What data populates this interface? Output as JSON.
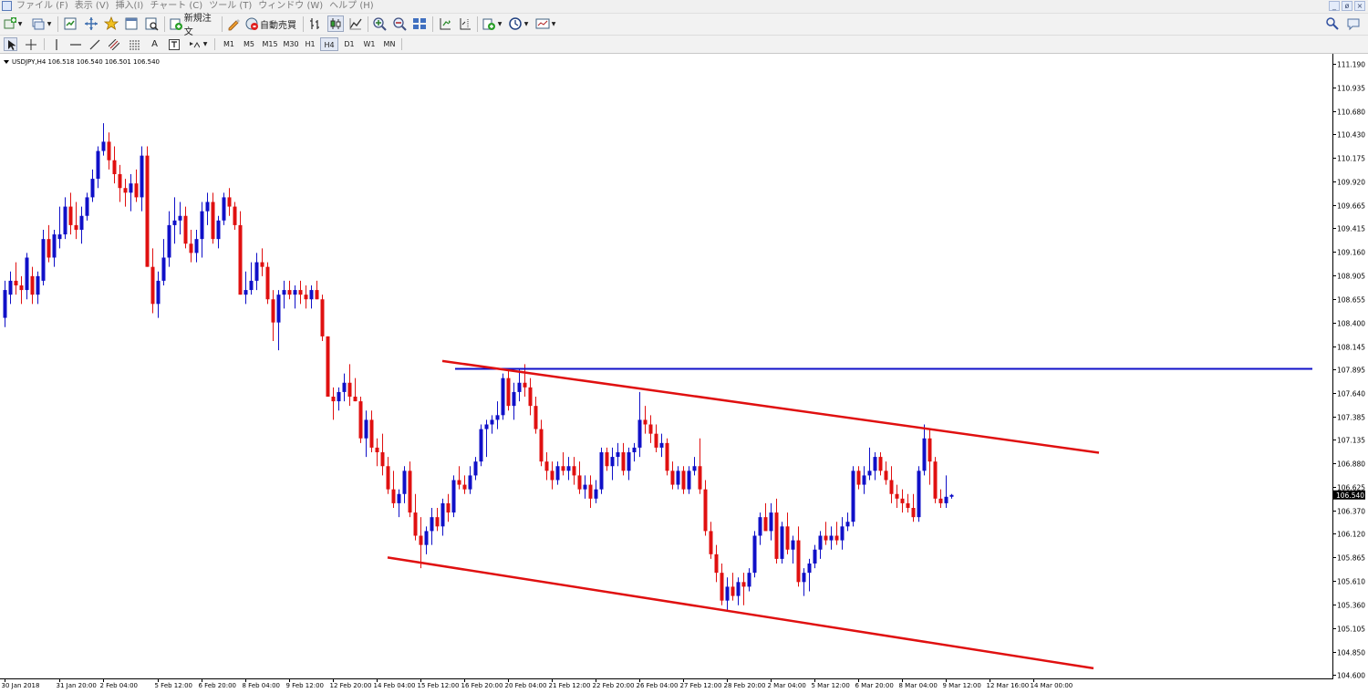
{
  "menu": {
    "items": [
      "ファイル (F)",
      "表示 (V)",
      "挿入(I)",
      "チャート (C)",
      "ツール (T)",
      "ウィンドウ (W)",
      "ヘルプ (H)"
    ]
  },
  "window_controls": [
    "_",
    "ø",
    "×"
  ],
  "toolbar": {
    "new_order_label": "新規注文",
    "auto_trade_label": "自動売買"
  },
  "timeframes": [
    "M1",
    "M5",
    "M15",
    "M30",
    "H1",
    "H4",
    "D1",
    "W1",
    "MN"
  ],
  "active_timeframe": "H4",
  "symbol_info": "USDJPY,H4  106.518 106.540 106.501 106.540",
  "colors": {
    "bull": "#1010c8",
    "bear": "#e01010",
    "trendline": "#e01010",
    "horizontal_line": "#1010c8",
    "price_tag_bg": "#000000"
  },
  "chart_data": {
    "type": "candlestick",
    "symbol": "USDJPY",
    "timeframe": "H4",
    "ylim": [
      104.475,
      111.313
    ],
    "price_ticks": [
      "111.190",
      "110.935",
      "110.680",
      "110.430",
      "110.175",
      "109.920",
      "109.665",
      "109.415",
      "109.160",
      "108.905",
      "108.655",
      "108.400",
      "108.145",
      "107.895",
      "107.640",
      "107.385",
      "107.135",
      "106.880",
      "106.625",
      "106.370",
      "106.120",
      "105.865",
      "105.610",
      "105.360",
      "105.105",
      "104.850",
      "104.600"
    ],
    "current_price": "106.540",
    "date_ticks": [
      {
        "label": "30 Jan 2018",
        "index": 0
      },
      {
        "label": "31 Jan 20:00",
        "index": 10
      },
      {
        "label": "2 Feb 04:00",
        "index": 18
      },
      {
        "label": "5 Feb 12:00",
        "index": 28
      },
      {
        "label": "6 Feb 20:00",
        "index": 36
      },
      {
        "label": "8 Feb 04:00",
        "index": 44
      },
      {
        "label": "9 Feb 12:00",
        "index": 52
      },
      {
        "label": "12 Feb 20:00",
        "index": 60
      },
      {
        "label": "14 Feb 04:00",
        "index": 68
      },
      {
        "label": "15 Feb 12:00",
        "index": 76
      },
      {
        "label": "16 Feb 20:00",
        "index": 84
      },
      {
        "label": "20 Feb 04:00",
        "index": 92
      },
      {
        "label": "21 Feb 12:00",
        "index": 100
      },
      {
        "label": "22 Feb 20:00",
        "index": 108
      },
      {
        "label": "26 Feb 04:00",
        "index": 116
      },
      {
        "label": "27 Feb 12:00",
        "index": 124
      },
      {
        "label": "28 Feb 20:00",
        "index": 132
      },
      {
        "label": "2 Mar 04:00",
        "index": 140
      },
      {
        "label": "5 Mar 12:00",
        "index": 148
      },
      {
        "label": "6 Mar 20:00",
        "index": 156
      },
      {
        "label": "8 Mar 04:00",
        "index": 164
      },
      {
        "label": "9 Mar 12:00",
        "index": 172
      },
      {
        "label": "12 Mar 16:00",
        "index": 180
      },
      {
        "label": "14 Mar 00:00",
        "index": 188
      }
    ],
    "candles": [
      [
        108.45,
        108.85,
        108.35,
        108.75
      ],
      [
        108.7,
        108.95,
        108.6,
        108.85
      ],
      [
        108.85,
        109.05,
        108.7,
        108.8
      ],
      [
        108.8,
        108.9,
        108.6,
        108.75
      ],
      [
        108.75,
        109.15,
        108.65,
        109.1
      ],
      [
        108.9,
        109.0,
        108.6,
        108.7
      ],
      [
        108.7,
        108.95,
        108.6,
        108.9
      ],
      [
        108.85,
        109.4,
        108.8,
        109.3
      ],
      [
        109.3,
        109.45,
        109.05,
        109.1
      ],
      [
        109.1,
        109.4,
        109.0,
        109.35
      ],
      [
        109.3,
        109.65,
        109.2,
        109.35
      ],
      [
        109.35,
        109.75,
        109.3,
        109.65
      ],
      [
        109.65,
        109.8,
        109.35,
        109.45
      ],
      [
        109.45,
        109.7,
        109.3,
        109.4
      ],
      [
        109.4,
        109.65,
        109.25,
        109.55
      ],
      [
        109.55,
        109.8,
        109.5,
        109.75
      ],
      [
        109.75,
        110.05,
        109.7,
        109.95
      ],
      [
        109.95,
        110.3,
        109.85,
        110.25
      ],
      [
        110.25,
        110.55,
        110.2,
        110.35
      ],
      [
        110.35,
        110.45,
        110.05,
        110.15
      ],
      [
        110.15,
        110.3,
        109.9,
        110.0
      ],
      [
        110.0,
        110.1,
        109.7,
        109.85
      ],
      [
        109.85,
        109.95,
        109.65,
        109.8
      ],
      [
        109.8,
        110.0,
        109.6,
        109.9
      ],
      [
        109.9,
        110.05,
        109.7,
        109.75
      ],
      [
        109.75,
        110.3,
        109.6,
        110.2
      ],
      [
        110.2,
        110.3,
        109.0,
        109.0
      ],
      [
        109.0,
        109.2,
        108.5,
        108.6
      ],
      [
        108.6,
        108.95,
        108.45,
        108.85
      ],
      [
        108.85,
        109.3,
        108.8,
        109.1
      ],
      [
        109.1,
        109.6,
        109.0,
        109.45
      ],
      [
        109.45,
        109.75,
        109.25,
        109.5
      ],
      [
        109.5,
        109.7,
        109.35,
        109.55
      ],
      [
        109.55,
        109.65,
        109.2,
        109.25
      ],
      [
        109.25,
        109.4,
        109.05,
        109.15
      ],
      [
        109.15,
        109.4,
        109.05,
        109.3
      ],
      [
        109.3,
        109.7,
        109.1,
        109.6
      ],
      [
        109.6,
        109.8,
        109.45,
        109.7
      ],
      [
        109.7,
        109.8,
        109.25,
        109.3
      ],
      [
        109.3,
        109.55,
        109.2,
        109.5
      ],
      [
        109.5,
        109.8,
        109.45,
        109.75
      ],
      [
        109.75,
        109.85,
        109.55,
        109.65
      ],
      [
        109.65,
        109.7,
        109.4,
        109.45
      ],
      [
        109.45,
        109.6,
        108.7,
        108.7
      ],
      [
        108.7,
        108.95,
        108.6,
        108.75
      ],
      [
        108.75,
        109.05,
        108.7,
        108.85
      ],
      [
        108.85,
        109.15,
        108.75,
        109.05
      ],
      [
        109.05,
        109.2,
        108.9,
        109.0
      ],
      [
        109.0,
        109.05,
        108.6,
        108.65
      ],
      [
        108.65,
        108.75,
        108.2,
        108.4
      ],
      [
        108.4,
        108.75,
        108.1,
        108.7
      ],
      [
        108.7,
        108.85,
        108.55,
        108.75
      ],
      [
        108.75,
        108.85,
        108.65,
        108.7
      ],
      [
        108.7,
        108.8,
        108.55,
        108.75
      ],
      [
        108.75,
        108.85,
        108.6,
        108.7
      ],
      [
        108.7,
        108.8,
        108.55,
        108.65
      ],
      [
        108.65,
        108.8,
        108.55,
        108.75
      ],
      [
        108.75,
        108.85,
        108.65,
        108.65
      ],
      [
        108.65,
        108.7,
        108.2,
        108.25
      ],
      [
        108.25,
        108.25,
        107.6,
        107.6
      ],
      [
        107.6,
        107.7,
        107.35,
        107.55
      ],
      [
        107.55,
        107.7,
        107.45,
        107.65
      ],
      [
        107.65,
        107.85,
        107.55,
        107.75
      ],
      [
        107.75,
        107.95,
        107.5,
        107.6
      ],
      [
        107.6,
        107.8,
        107.55,
        107.55
      ],
      [
        107.55,
        107.6,
        107.1,
        107.15
      ],
      [
        107.15,
        107.45,
        106.95,
        107.35
      ],
      [
        107.35,
        107.45,
        107.0,
        107.05
      ],
      [
        107.05,
        107.15,
        106.85,
        107.0
      ],
      [
        107.0,
        107.2,
        106.75,
        106.85
      ],
      [
        106.85,
        106.95,
        106.55,
        106.6
      ],
      [
        106.6,
        106.8,
        106.4,
        106.45
      ],
      [
        106.45,
        106.6,
        106.3,
        106.55
      ],
      [
        106.55,
        106.85,
        106.45,
        106.8
      ],
      [
        106.8,
        106.9,
        106.3,
        106.35
      ],
      [
        106.35,
        106.55,
        106.05,
        106.1
      ],
      [
        106.1,
        106.3,
        105.75,
        106.0
      ],
      [
        106.0,
        106.2,
        105.9,
        106.15
      ],
      [
        106.15,
        106.4,
        106.0,
        106.3
      ],
      [
        106.3,
        106.4,
        106.15,
        106.2
      ],
      [
        106.2,
        106.5,
        106.1,
        106.45
      ],
      [
        106.45,
        106.55,
        106.25,
        106.35
      ],
      [
        106.35,
        106.75,
        106.3,
        106.7
      ],
      [
        106.7,
        106.85,
        106.6,
        106.65
      ],
      [
        106.65,
        106.75,
        106.55,
        106.6
      ],
      [
        106.6,
        106.85,
        106.55,
        106.75
      ],
      [
        106.75,
        106.95,
        106.7,
        106.9
      ],
      [
        106.9,
        107.3,
        106.85,
        107.25
      ],
      [
        107.25,
        107.35,
        106.95,
        107.3
      ],
      [
        107.3,
        107.4,
        107.2,
        107.35
      ],
      [
        107.35,
        107.55,
        107.25,
        107.4
      ],
      [
        107.4,
        107.85,
        107.35,
        107.8
      ],
      [
        107.8,
        107.9,
        107.45,
        107.5
      ],
      [
        107.5,
        107.75,
        107.35,
        107.65
      ],
      [
        107.65,
        107.9,
        107.55,
        107.75
      ],
      [
        107.75,
        107.95,
        107.6,
        107.7
      ],
      [
        107.7,
        107.8,
        107.4,
        107.5
      ],
      [
        107.5,
        107.6,
        107.2,
        107.25
      ],
      [
        107.25,
        107.35,
        106.85,
        106.9
      ],
      [
        106.9,
        107.0,
        106.7,
        106.8
      ],
      [
        106.8,
        106.9,
        106.6,
        106.7
      ],
      [
        106.7,
        106.9,
        106.65,
        106.85
      ],
      [
        106.85,
        107.0,
        106.75,
        106.8
      ],
      [
        106.8,
        106.95,
        106.7,
        106.85
      ],
      [
        106.85,
        106.95,
        106.65,
        106.75
      ],
      [
        106.75,
        106.9,
        106.55,
        106.6
      ],
      [
        106.6,
        106.75,
        106.5,
        106.65
      ],
      [
        106.65,
        106.75,
        106.4,
        106.5
      ],
      [
        106.5,
        106.7,
        106.45,
        106.6
      ],
      [
        106.6,
        107.05,
        106.55,
        107.0
      ],
      [
        107.0,
        107.05,
        106.8,
        106.85
      ],
      [
        106.85,
        107.05,
        106.7,
        106.95
      ],
      [
        106.95,
        107.1,
        106.85,
        107.0
      ],
      [
        107.0,
        107.1,
        106.75,
        106.8
      ],
      [
        106.8,
        107.05,
        106.7,
        107.0
      ],
      [
        107.0,
        107.1,
        106.9,
        107.05
      ],
      [
        107.05,
        107.65,
        106.95,
        107.35
      ],
      [
        107.35,
        107.5,
        107.2,
        107.3
      ],
      [
        107.3,
        107.4,
        107.1,
        107.2
      ],
      [
        107.2,
        107.3,
        107.0,
        107.05
      ],
      [
        107.05,
        107.2,
        106.95,
        107.1
      ],
      [
        107.1,
        107.15,
        106.75,
        106.8
      ],
      [
        106.8,
        106.9,
        106.6,
        106.65
      ],
      [
        106.65,
        106.85,
        106.6,
        106.8
      ],
      [
        106.8,
        106.85,
        106.55,
        106.6
      ],
      [
        106.6,
        106.85,
        106.55,
        106.8
      ],
      [
        106.8,
        106.95,
        106.75,
        106.85
      ],
      [
        106.85,
        107.15,
        106.55,
        106.6
      ],
      [
        106.6,
        106.7,
        106.1,
        106.15
      ],
      [
        106.15,
        106.25,
        105.85,
        105.9
      ],
      [
        105.9,
        106.0,
        105.6,
        105.7
      ],
      [
        105.7,
        105.8,
        105.35,
        105.4
      ],
      [
        105.4,
        105.65,
        105.3,
        105.55
      ],
      [
        105.55,
        105.7,
        105.4,
        105.45
      ],
      [
        105.45,
        105.65,
        105.35,
        105.6
      ],
      [
        105.6,
        105.7,
        105.35,
        105.55
      ],
      [
        105.55,
        105.75,
        105.5,
        105.7
      ],
      [
        105.7,
        106.15,
        105.65,
        106.1
      ],
      [
        106.1,
        106.35,
        106.0,
        106.3
      ],
      [
        106.3,
        106.45,
        106.2,
        106.15
      ],
      [
        106.15,
        106.45,
        106.05,
        106.35
      ],
      [
        106.35,
        106.5,
        105.8,
        105.85
      ],
      [
        105.85,
        106.25,
        105.8,
        106.2
      ],
      [
        106.2,
        106.35,
        105.9,
        105.95
      ],
      [
        105.95,
        106.1,
        105.8,
        106.05
      ],
      [
        106.05,
        106.2,
        105.55,
        105.6
      ],
      [
        105.6,
        105.75,
        105.45,
        105.7
      ],
      [
        105.7,
        105.85,
        105.5,
        105.8
      ],
      [
        105.8,
        106.0,
        105.75,
        105.95
      ],
      [
        105.95,
        106.15,
        105.85,
        106.1
      ],
      [
        106.1,
        106.25,
        106.0,
        106.05
      ],
      [
        106.05,
        106.2,
        105.95,
        106.1
      ],
      [
        106.1,
        106.25,
        106.0,
        106.05
      ],
      [
        106.05,
        106.3,
        105.95,
        106.2
      ],
      [
        106.2,
        106.35,
        106.15,
        106.25
      ],
      [
        106.25,
        106.85,
        106.2,
        106.8
      ],
      [
        106.8,
        106.85,
        106.6,
        106.65
      ],
      [
        106.65,
        106.85,
        106.55,
        106.75
      ],
      [
        106.75,
        107.05,
        106.7,
        106.8
      ],
      [
        106.8,
        107.0,
        106.7,
        106.95
      ],
      [
        106.95,
        107.0,
        106.75,
        106.8
      ],
      [
        106.8,
        106.9,
        106.65,
        106.7
      ],
      [
        106.7,
        106.85,
        106.45,
        106.55
      ],
      [
        106.55,
        106.65,
        106.4,
        106.5
      ],
      [
        106.5,
        106.6,
        106.35,
        106.45
      ],
      [
        106.45,
        106.55,
        106.35,
        106.4
      ],
      [
        106.4,
        106.55,
        106.25,
        106.3
      ],
      [
        106.3,
        106.85,
        106.25,
        106.8
      ],
      [
        106.8,
        107.3,
        106.75,
        107.15
      ],
      [
        107.15,
        107.25,
        106.65,
        106.9
      ],
      [
        106.9,
        106.95,
        106.45,
        106.5
      ],
      [
        106.5,
        106.6,
        106.4,
        106.45
      ],
      [
        106.45,
        106.75,
        106.4,
        106.52
      ],
      [
        106.52,
        106.55,
        106.5,
        106.54
      ]
    ],
    "lines": [
      {
        "type": "horizontal",
        "price": 107.9,
        "from_index": 84,
        "color": "#1010c8"
      },
      {
        "type": "trendline",
        "points": [
          [
            80,
            107.985
          ],
          [
            200,
            106.995
          ]
        ],
        "color": "#e01010"
      },
      {
        "type": "trendline",
        "points": [
          [
            70,
            105.865
          ],
          [
            199,
            104.67
          ]
        ],
        "color": "#e01010"
      }
    ]
  }
}
